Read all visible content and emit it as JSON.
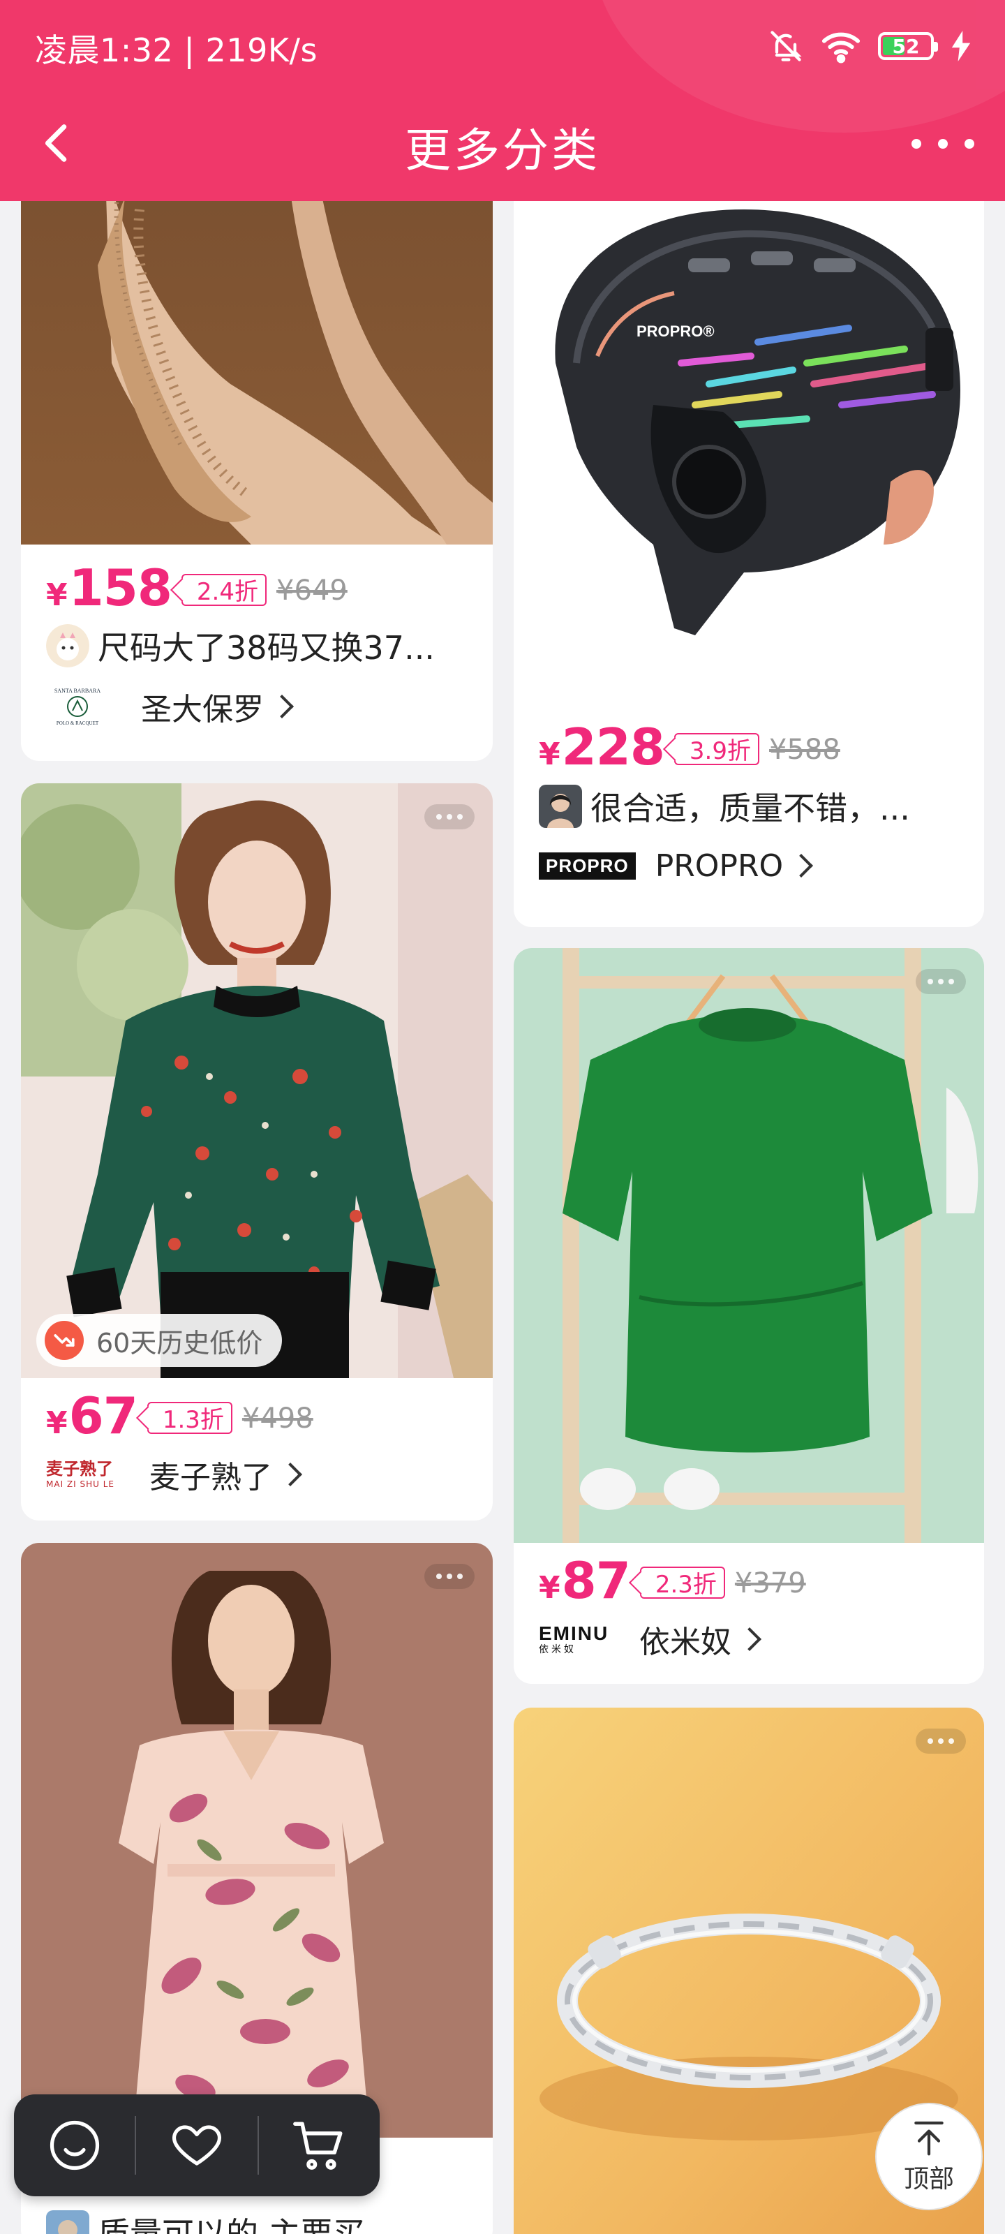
{
  "status_bar": {
    "time_speed": "凌晨1:32 | 219K/s",
    "battery": "52",
    "battery_level": 0.52,
    "icons": [
      "mute-bell-icon",
      "wifi-icon",
      "battery-icon",
      "charging-bolt-icon"
    ]
  },
  "nav": {
    "title": "更多分类",
    "back_icon": "chevron-left-icon",
    "more_icon": "more-dots-icon"
  },
  "products": [
    {
      "price_symbol": "¥",
      "price": "158",
      "discount": "2.4折",
      "original_price": "¥649",
      "review": "尺码大了38码又换37...",
      "brand": "圣大保罗",
      "brand_logo_text": "SANTA BARBARA POLO & RACQUET CLUB"
    },
    {
      "price_symbol": "¥",
      "price": "228",
      "discount": "3.9折",
      "original_price": "¥588",
      "review": "很合适，质量不错，...",
      "brand": "PROPRO",
      "brand_logo_text": "PROPRO",
      "helmet_text": "PROPRO®"
    },
    {
      "price_symbol": "¥",
      "price": "67",
      "discount": "1.3折",
      "original_price": "¥498",
      "badge": "60天历史低价",
      "brand": "麦子熟了",
      "brand_logo_text": "麦子熟了",
      "brand_logo_sub": "MAI ZI SHU LE"
    },
    {
      "price_symbol": "¥",
      "price": "87",
      "discount": "2.3折",
      "original_price": "¥379",
      "brand": "依米奴",
      "brand_logo_text": "EMINU",
      "brand_logo_sub": "依米奴"
    },
    {
      "review": "质量可以的 主要买"
    }
  ],
  "float_bar": {
    "icons": [
      "smile-icon",
      "heart-icon",
      "cart-icon"
    ]
  },
  "top_button": {
    "label": "顶部",
    "icon": "arrow-up-icon"
  },
  "colors": {
    "header": "#f0386a",
    "price": "#f0287a",
    "page_bg": "#f2f2f4"
  }
}
